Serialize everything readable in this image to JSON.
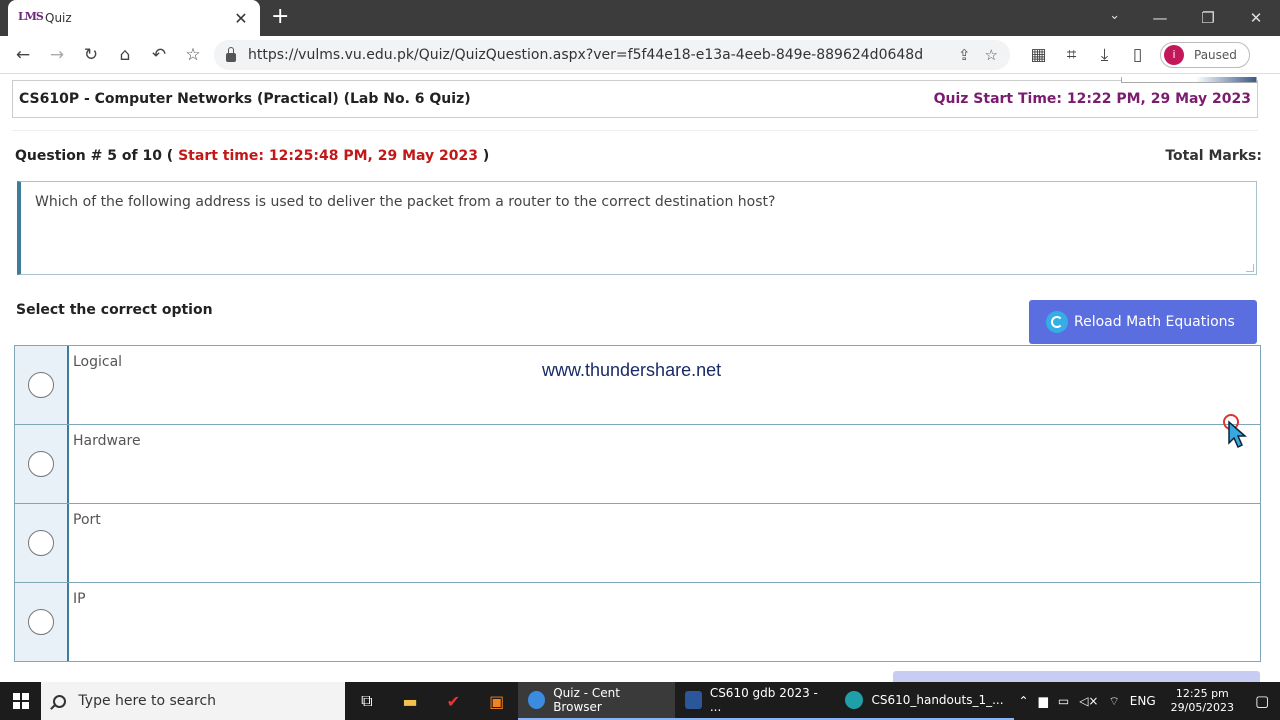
{
  "browser": {
    "tab_title": "Quiz",
    "tab_favicon": "LMS",
    "url": "https://vulms.vu.edu.pk/Quiz/QuizQuestion.aspx?ver=f5f44e18-e13a-4eeb-849e-889624d0648d",
    "profile_initial": "i",
    "profile_status": "Paused"
  },
  "quiz": {
    "course_title": "CS610P - Computer Networks (Practical) (Lab No. 6 Quiz)",
    "quiz_start_label": "Quiz Start Time:",
    "quiz_start_value": "12:22 PM, 29 May 2023",
    "question_number": "Question # 5 of 10 (",
    "start_time_text": "Start time: 12:25:48 PM, 29 May 2023",
    "question_paren_close": ")",
    "total_marks_label": "Total Marks:",
    "question_text": "Which of the following address is used to deliver the packet from a router to the correct destination host?",
    "select_label": "Select the correct option",
    "reload_button": "Reload Math Equations",
    "options": [
      "Logical",
      "Hardware",
      "Port",
      "IP"
    ]
  },
  "watermark": "www.thundershare.net",
  "taskbar": {
    "search_placeholder": "Type here to search",
    "apps": [
      "Quiz - Cent Browser",
      "CS610 gdb 2023 - ...",
      "CS610_handouts_1_..."
    ],
    "language": "ENG",
    "time": "12:25 pm",
    "date": "29/05/2023"
  },
  "colors": {
    "accent_button": "#5b6ee0",
    "start_time_red": "#c21818",
    "quiz_start_purple": "#7b1d6f",
    "option_border": "#3e7c97"
  }
}
